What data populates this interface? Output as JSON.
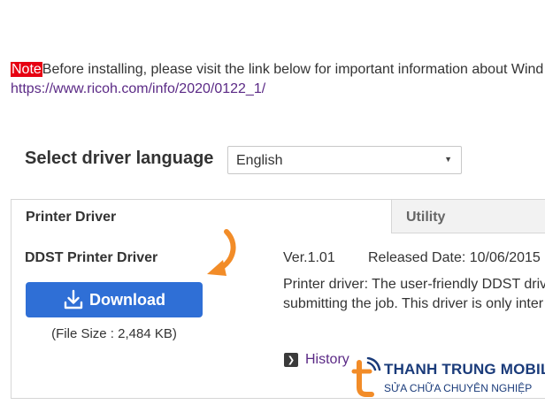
{
  "notice": {
    "badge": "Note",
    "text": "Before installing, please visit the link below for important information about Wind",
    "link": "https://www.ricoh.com/info/2020/0122_1/"
  },
  "language": {
    "label": "Select driver language",
    "selected": "English"
  },
  "tabs": [
    {
      "label": "Printer Driver",
      "active": true
    },
    {
      "label": "Utility",
      "active": false
    }
  ],
  "driver": {
    "name": "DDST Printer Driver",
    "download_label": "Download",
    "file_size": "(File Size : 2,484 KB)",
    "version": "Ver.1.01",
    "released": "Released Date: 10/06/2015",
    "description_line1": "Printer driver: The user-friendly DDST driv",
    "description_line2": "submitting the job. This driver is only inter",
    "history_label": "History"
  },
  "watermark": {
    "title": "THANH TRUNG MOBILE",
    "subtitle": "SỬA CHỮA CHUYÊN NGHIỆP"
  },
  "colors": {
    "note_badge": "#e60012",
    "download_button": "#2f6fd6",
    "link": "#5b2a86",
    "arrow": "#f28c28",
    "watermark_navy": "#1a3b7a",
    "watermark_orange": "#f28c28"
  },
  "icons": {
    "download": "download-icon",
    "history": "chevron-right-square-icon",
    "select_arrow": "triangle-down-icon",
    "pointer": "curved-arrow-icon"
  }
}
